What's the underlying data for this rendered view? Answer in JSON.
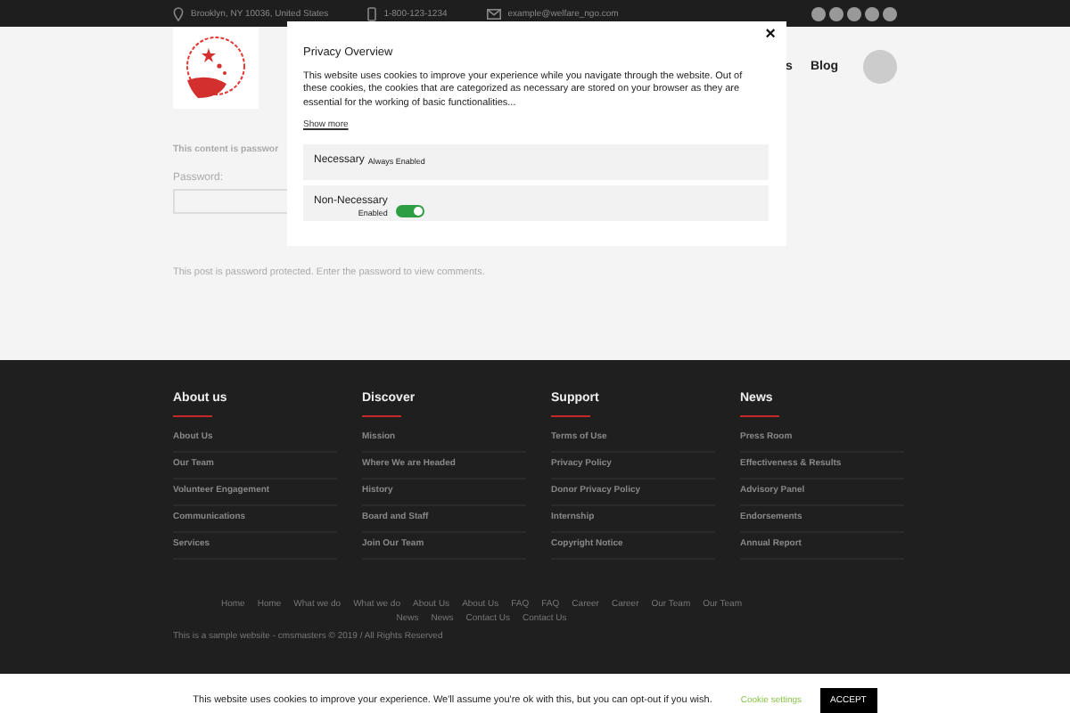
{
  "topbar": {
    "address": "Brooklyn, NY 10036, United States",
    "phone": "1-800-123-1234",
    "email": "example@welfare_ngo.com"
  },
  "nav": [
    "s",
    "Blog"
  ],
  "content": {
    "protected_text": "This content is passwor",
    "password_label": "Password:",
    "post_note": "This post is password protected. Enter the password to view comments."
  },
  "modal": {
    "title": "Privacy Overview",
    "body": "This website uses cookies to improve your experience while you navigate through the website. Out of these cookies, the cookies that are categorized as necessary are stored on your browser as they are essential for the working of basic functionalities...",
    "show_more": "Show more",
    "close": "×",
    "categories": [
      {
        "kind": "fixed",
        "name": "Necessary",
        "status": "Always Enabled"
      },
      {
        "kind": "toggle",
        "name": "Non-Necessary",
        "status": "Enabled",
        "on": true
      }
    ]
  },
  "footer": {
    "columns": [
      {
        "title": "About us",
        "links": [
          "About Us",
          "Our Team",
          "Volunteer Engagement",
          "Communications",
          "Services"
        ]
      },
      {
        "title": "Discover",
        "links": [
          "Mission",
          "Where We are Headed",
          "History",
          "Board and Staff",
          "Join Our Team"
        ]
      },
      {
        "title": "Support",
        "links": [
          "Terms of Use",
          "Privacy Policy",
          "Donor Privacy Policy",
          "Internship",
          "Copyright Notice"
        ]
      },
      {
        "title": "News",
        "links": [
          "Press Room",
          "Effectiveness & Results",
          "Advisory Panel",
          "Endorsements",
          "Annual Report"
        ]
      }
    ],
    "bottom_links": [
      "Home",
      "Home",
      "What we do",
      "What we do",
      "About Us",
      "About Us",
      "FAQ",
      "FAQ",
      "Career",
      "Career",
      "Our Team",
      "Our Team",
      "News",
      "News",
      "Contact Us",
      "Contact Us"
    ],
    "copyright": "This is a sample website - cmsmasters © 2019 / All Rights Reserved"
  },
  "cookie_bar": {
    "text": "This website uses cookies to improve your experience. We'll assume you're ok with this, but you can opt-out if you wish.",
    "settings": "Cookie settings",
    "accept": "ACCEPT"
  }
}
